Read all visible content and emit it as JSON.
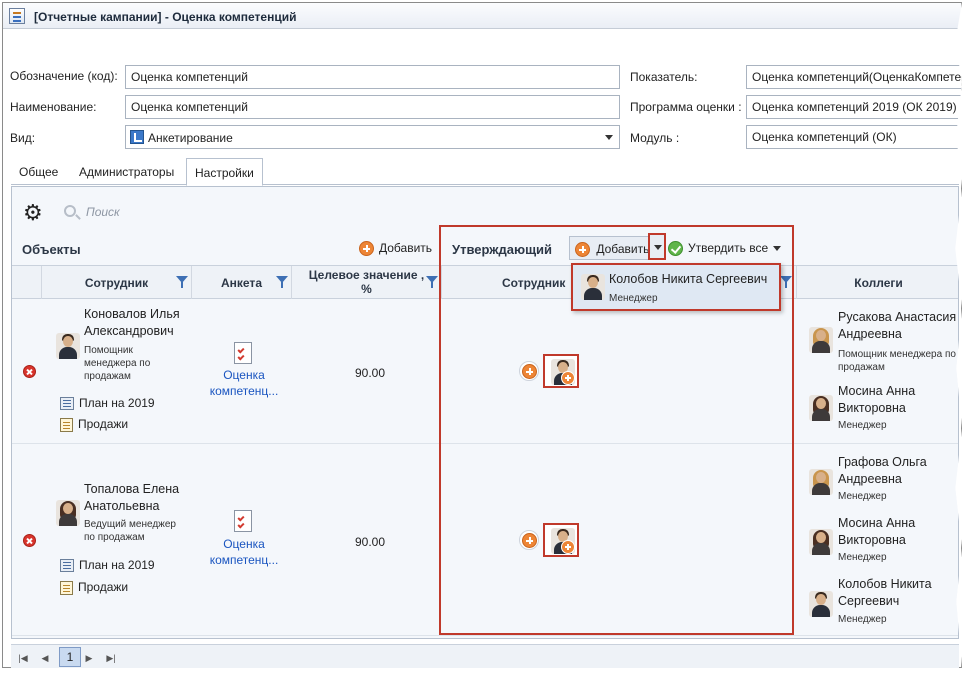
{
  "window": {
    "title": "[Отчетные кампании] - Оценка компетенций"
  },
  "form": {
    "code_label": "Обозначение (код):",
    "code_value": "Оценка компетенций",
    "name_label": "Наименование:",
    "name_value": "Оценка компетенций",
    "type_label": "Вид:",
    "type_value": "Анкетирование",
    "indicator_label": "Показатель:",
    "indicator_value": "Оценка компетенций(ОценкаКомпете",
    "program_label": "Программа оценки :",
    "program_value": "Оценка компетенций 2019 (ОК 2019)",
    "module_label": "Модуль :",
    "module_value": "Оценка компетенций (ОК)"
  },
  "tabs": [
    "Общее",
    "Администраторы",
    "Настройки"
  ],
  "toolbar": {
    "search_label": "Поиск"
  },
  "objects": {
    "title": "Объекты",
    "add_label": "Добавить"
  },
  "approver": {
    "title": "Утверждающий",
    "add_label": "Добавить",
    "approve_all_label": "Утвердить все"
  },
  "columns": {
    "employee": "Сотрудник",
    "survey": "Анкета",
    "target_line1": "Целевое значение ,",
    "target_line2": "%",
    "approver_employee": "Сотрудник",
    "colleagues": "Коллеги"
  },
  "dropdown": {
    "name": "Колобов Никита Сергеевич",
    "position": "Менеджер"
  },
  "rows": [
    {
      "name_line1": "Коновалов Илья",
      "name_line2": "Александрович",
      "position_line1": "Помощник",
      "position_line2": "менеджера по",
      "position_line3": "продажам",
      "plan": "План на 2019",
      "department": "Продажи",
      "survey_line1": "Оценка",
      "survey_line2": "компетенц...",
      "target": "90.00",
      "colleagues": [
        {
          "name_line1": "Русакова Анастасия",
          "name_line2": "Андреевна",
          "position": "Помощник менеджера по",
          "position_line2": "продажам"
        },
        {
          "name_line1": "Мосина Анна",
          "name_line2": "Викторовна",
          "position": "Менеджер"
        }
      ]
    },
    {
      "name_line1": "Топалова Елена",
      "name_line2": "Анатольевна",
      "position_line1": "Ведущий менеджер",
      "position_line2": "по продажам",
      "plan": "План на 2019",
      "department": "Продажи",
      "survey_line1": "Оценка",
      "survey_line2": "компетенц...",
      "target": "90.00",
      "colleagues": [
        {
          "name_line1": "Графова Ольга",
          "name_line2": "Андреевна",
          "position": "Менеджер"
        },
        {
          "name_line1": "Мосина Анна",
          "name_line2": "Викторовна",
          "position": "Менеджер"
        },
        {
          "name_line1": "Колобов Никита",
          "name_line2": "Сергеевич",
          "position": "Менеджер"
        }
      ]
    }
  ],
  "pager": {
    "current_page": "1"
  },
  "colors": {
    "highlight": "#c0392b",
    "accent_orange": "#ed8536",
    "link": "#1a55c0"
  }
}
